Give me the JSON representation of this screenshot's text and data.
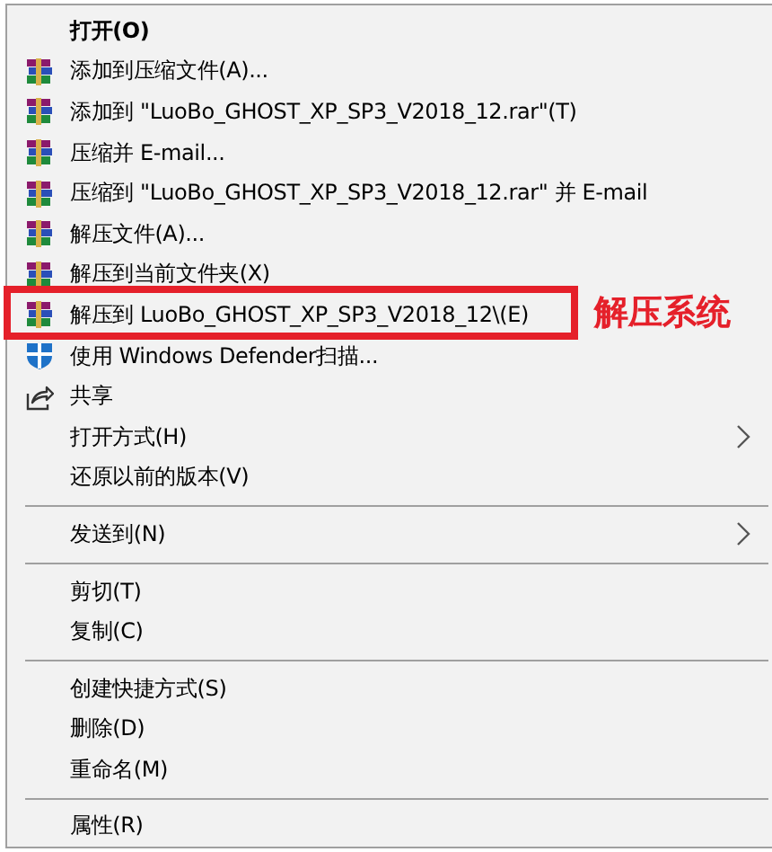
{
  "menu": {
    "items": [
      {
        "kind": "plain",
        "label": "打开(O)",
        "bold": true,
        "submenu": false,
        "highlighted": false
      },
      {
        "kind": "archive",
        "label": "添加到压缩文件(A)...",
        "bold": false,
        "submenu": false,
        "highlighted": false
      },
      {
        "kind": "archive",
        "label": "添加到 \"LuoBo_GHOST_XP_SP3_V2018_12.rar\"(T)",
        "bold": false,
        "submenu": false,
        "highlighted": false
      },
      {
        "kind": "archive",
        "label": "压缩并 E-mail...",
        "bold": false,
        "submenu": false,
        "highlighted": false
      },
      {
        "kind": "archive",
        "label": "压缩到 \"LuoBo_GHOST_XP_SP3_V2018_12.rar\" 并 E-mail",
        "bold": false,
        "submenu": false,
        "highlighted": false
      },
      {
        "kind": "archive",
        "label": "解压文件(A)...",
        "bold": false,
        "submenu": false,
        "highlighted": false
      },
      {
        "kind": "archive",
        "label": "解压到当前文件夹(X)",
        "bold": false,
        "submenu": false,
        "highlighted": false
      },
      {
        "kind": "archive",
        "label": "解压到 LuoBo_GHOST_XP_SP3_V2018_12\\(E)",
        "bold": false,
        "submenu": false,
        "highlighted": true
      },
      {
        "kind": "shield",
        "label": "使用 Windows Defender扫描...",
        "bold": false,
        "submenu": false,
        "highlighted": false
      },
      {
        "kind": "share",
        "label": "共享",
        "bold": false,
        "submenu": false,
        "highlighted": false
      },
      {
        "kind": "plain",
        "label": "打开方式(H)",
        "bold": false,
        "submenu": true,
        "highlighted": false
      },
      {
        "kind": "plain",
        "label": "还原以前的版本(V)",
        "bold": false,
        "submenu": false,
        "highlighted": false
      },
      {
        "kind": "separator"
      },
      {
        "kind": "plain",
        "label": "发送到(N)",
        "bold": false,
        "submenu": true,
        "highlighted": false
      },
      {
        "kind": "separator"
      },
      {
        "kind": "plain",
        "label": "剪切(T)",
        "bold": false,
        "submenu": false,
        "highlighted": false
      },
      {
        "kind": "plain",
        "label": "复制(C)",
        "bold": false,
        "submenu": false,
        "highlighted": false
      },
      {
        "kind": "separator"
      },
      {
        "kind": "plain",
        "label": "创建快捷方式(S)",
        "bold": false,
        "submenu": false,
        "highlighted": false
      },
      {
        "kind": "plain",
        "label": "删除(D)",
        "bold": false,
        "submenu": false,
        "highlighted": false
      },
      {
        "kind": "plain",
        "label": "重命名(M)",
        "bold": false,
        "submenu": false,
        "highlighted": false
      },
      {
        "kind": "separator"
      },
      {
        "kind": "plain",
        "label": "属性(R)",
        "bold": false,
        "submenu": false,
        "highlighted": false
      }
    ]
  },
  "annotation": {
    "label": "解压系统"
  }
}
